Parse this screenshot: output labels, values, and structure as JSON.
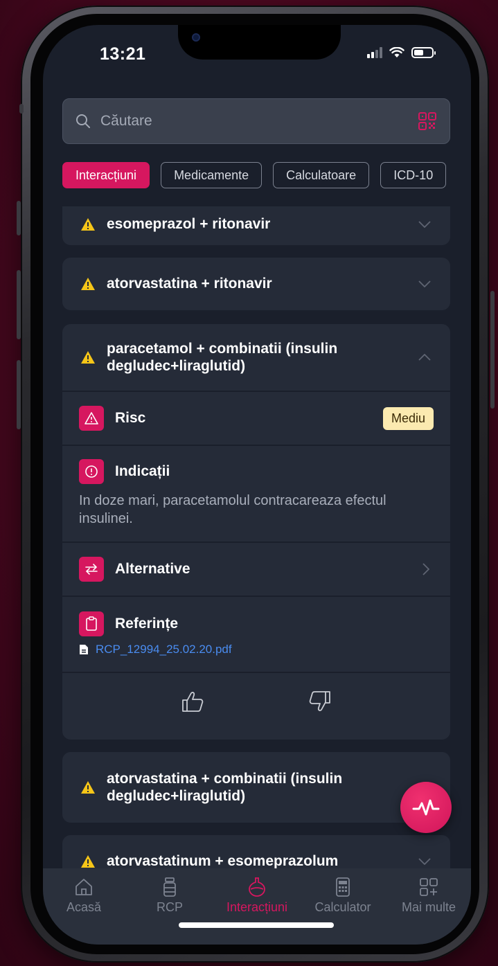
{
  "status": {
    "time": "13:21"
  },
  "search": {
    "placeholder": "Căutare"
  },
  "chips": [
    "Interacțiuni",
    "Medicamente",
    "Calculatoare",
    "ICD-10"
  ],
  "cards": {
    "c1": {
      "title": "esomeprazol + ritonavir"
    },
    "c2": {
      "title": "atorvastatina + ritonavir"
    },
    "c3": {
      "title": "paracetamol + combinatii (insulin degludec+liraglutid)",
      "risk_label": "Risc",
      "risk_level": "Mediu",
      "indications_label": "Indicații",
      "indications_text": "In doze mari, paracetamolul contracareaza efectul insulinei.",
      "alternatives_label": "Alternative",
      "references_label": "Referințe",
      "reference_file": "RCP_12994_25.02.20.pdf"
    },
    "c4": {
      "title": "atorvastatina + combinatii (insulin degludec+liraglutid)"
    },
    "c5": {
      "title": "atorvastatinum + esomeprazolum"
    }
  },
  "tabbar": {
    "home": "Acasă",
    "rcp": "RCP",
    "interactions": "Interacțiuni",
    "calculator": "Calculator",
    "more": "Mai multe"
  },
  "colors": {
    "accent": "#d6175f",
    "warning": "#f5c518",
    "badge_bg": "#fbeab0",
    "link": "#4a8cf0"
  },
  "icons": [
    "search-icon",
    "qr-code-icon",
    "warning-icon",
    "chevron-down-icon",
    "chevron-up-icon",
    "chevron-right-icon",
    "alert-triangle-icon",
    "info-circle-icon",
    "swap-icon",
    "clipboard-icon",
    "file-icon",
    "thumbs-up-icon",
    "thumbs-down-icon",
    "pulse-icon",
    "home-icon",
    "pill-bottle-icon",
    "flask-icon",
    "calculator-icon",
    "grid-plus-icon"
  ]
}
